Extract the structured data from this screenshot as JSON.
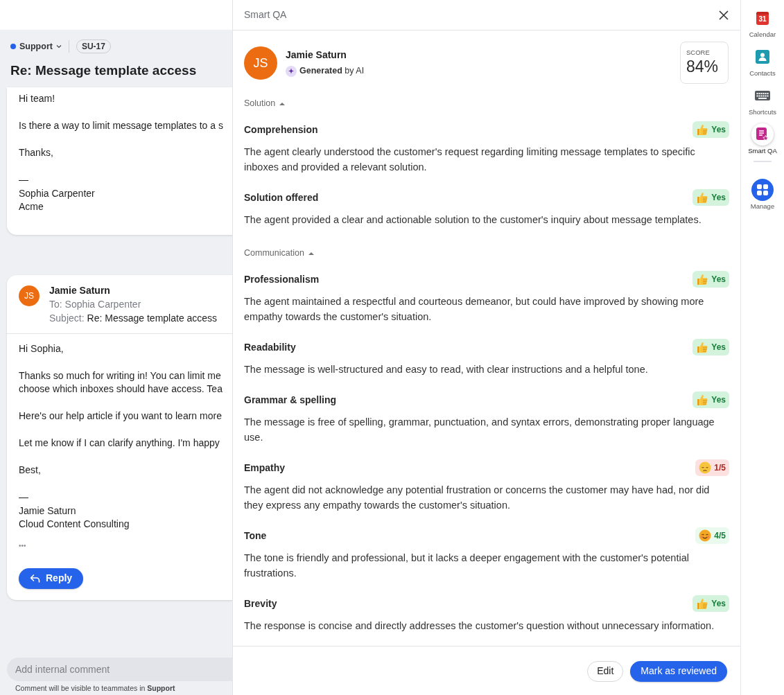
{
  "conversation": {
    "inbox": "Support",
    "tag": "SU-17",
    "title": "Re: Message template access",
    "first_message": {
      "paragraphs": [
        [
          "Hi team!"
        ],
        [
          "Is there a way to limit message templates to a s"
        ],
        [
          "Thanks,"
        ],
        [
          "—",
          "Sophia Carpenter",
          "Acme"
        ]
      ]
    },
    "reply_message": {
      "avatar": "JS",
      "sender": "Jamie Saturn",
      "to": "To: Sophia Carpenter",
      "subject_label": "Subject:",
      "subject": "Re: Message template access",
      "paragraphs": [
        [
          "Hi Sophia,"
        ],
        [
          "Thanks so much for writing in! You can limit me",
          "choose which inboxes should have access. Tea"
        ],
        [
          "Here's our help article if you want to learn more"
        ],
        [
          "Let me know if I can clarify anything. I'm happy"
        ],
        [
          "Best,"
        ],
        [
          "—",
          "Jamie Saturn",
          "Cloud Content Consulting"
        ]
      ],
      "more": "•••",
      "reply_button": "Reply"
    },
    "comment": {
      "placeholder": "Add internal comment",
      "hint": "Comment will be visible to teammates in **Support**"
    }
  },
  "panel": {
    "title": "Smart QA",
    "agent": {
      "avatar": "JS",
      "name": "Jamie Saturn",
      "generated": "**Generated** by AI"
    },
    "score": {
      "label": "SCORE",
      "value": "84%"
    },
    "sections": [
      {
        "title": "Solution",
        "expanded": true,
        "criteria": [
          {
            "name": "Comprehension",
            "badge": {
              "kind": "thumbs",
              "color": "#d3f3dc",
              "text": "Yes"
            },
            "description": "The agent clearly understood the customer's request regarding limiting message templates to specific inboxes and provided a relevant solution."
          },
          {
            "name": "Solution offered",
            "badge": {
              "kind": "thumbs",
              "color": "#d3f3dc",
              "text": "Yes"
            },
            "description": "The agent provided a clear and actionable solution to the customer's inquiry about message templates."
          }
        ]
      },
      {
        "title": "Communication",
        "expanded": true,
        "criteria": [
          {
            "name": "Professionalism",
            "badge": {
              "kind": "thumbs",
              "color": "#d3f3dc",
              "text": "Yes"
            },
            "description": "The agent maintained a respectful and courteous demeanor, but could have improved by showing more empathy towards the customer's situation."
          },
          {
            "name": "Readability",
            "badge": {
              "kind": "thumbs",
              "color": "#d3f3dc",
              "text": "Yes"
            },
            "description": "The message is well-structured and easy to read, with clear instructions and a helpful tone."
          },
          {
            "name": "Grammar & spelling",
            "badge": {
              "kind": "thumbs",
              "color": "#d3f3dc",
              "text": "Yes"
            },
            "description": "The message is free of spelling, grammar, punctuation, and syntax errors, demonstrating proper language use."
          },
          {
            "name": "Empathy",
            "badge": {
              "kind": "sad",
              "color": "#fde0e0",
              "text": "1/5"
            },
            "description": "The agent did not acknowledge any potential frustration or concerns the customer may have had, nor did they express any empathy towards the customer's situation."
          },
          {
            "name": "Tone",
            "badge": {
              "kind": "smile",
              "color": "#eafaee",
              "text": "4/5"
            },
            "description": "The tone is friendly and professional, but it lacks a deeper engagement with the customer's potential frustrations."
          },
          {
            "name": "Brevity",
            "badge": {
              "kind": "thumbs",
              "color": "#d3f3dc",
              "text": "Yes"
            },
            "description": "The response is concise and directly addresses the customer's question without unnecessary information."
          }
        ]
      }
    ],
    "buttons": [
      {
        "kind": "secondary",
        "label": "Edit"
      },
      {
        "kind": "primary",
        "label": "Mark as reviewed"
      }
    ]
  },
  "sidebar": {
    "items": [
      {
        "kind": "calendar",
        "label": "Calendar",
        "icon_text": "31",
        "selected": false
      },
      {
        "kind": "contacts",
        "label": "Contacts",
        "selected": false
      },
      {
        "kind": "shortcuts",
        "label": "Shortcuts",
        "selected": false
      },
      {
        "kind": "smartqa",
        "label": "Smart QA",
        "selected": true
      },
      {
        "kind": "manage",
        "label": "Manage",
        "selected": false
      }
    ]
  }
}
